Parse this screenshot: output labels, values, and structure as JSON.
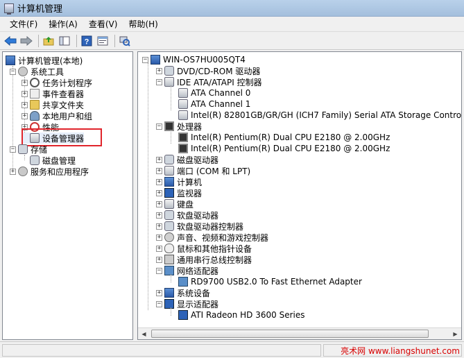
{
  "window": {
    "title": "计算机管理"
  },
  "menu": [
    "文件(F)",
    "操作(A)",
    "查看(V)",
    "帮助(H)"
  ],
  "toolbar": [
    "back-arrow-icon",
    "forward-arrow-icon",
    "up-folder-icon",
    "show-hide-tree-icon",
    "help-icon",
    "properties-icon",
    "scan-hardware-icon"
  ],
  "left_tree": {
    "root": "计算机管理(本地)",
    "system_tools": "系统工具",
    "task_scheduler": "任务计划程序",
    "event_viewer": "事件查看器",
    "shared_folders": "共享文件夹",
    "local_users": "本地用户和组",
    "performance": "性能",
    "device_manager": "设备管理器",
    "storage": "存储",
    "disk_management": "磁盘管理",
    "services_apps": "服务和应用程序"
  },
  "device_tree": {
    "computer_name": "WIN-OS7HU005QT4",
    "dvd": "DVD/CD-ROM 驱动器",
    "ide": "IDE ATA/ATAPI 控制器",
    "ide_children": [
      "ATA Channel 0",
      "ATA Channel 1",
      "Intel(R) 82801GB/GR/GH (ICH7 Family) Serial ATA Storage Controll"
    ],
    "processors": "处理器",
    "processor_children": [
      "Intel(R) Pentium(R) Dual  CPU  E2180  @ 2.00GHz",
      "Intel(R) Pentium(R) Dual  CPU  E2180  @ 2.00GHz"
    ],
    "disk_drives": "磁盘驱动器",
    "ports": "端口 (COM 和 LPT)",
    "computer": "计算机",
    "monitors": "监视器",
    "keyboards": "键盘",
    "floppy_drives": "软盘驱动器",
    "floppy_controllers": "软盘驱动器控制器",
    "sound": "声音、视频和游戏控制器",
    "mice": "鼠标和其他指针设备",
    "usb": "通用串行总线控制器",
    "network": "网络适配器",
    "network_children": [
      "RD9700 USB2.0 To Fast Ethernet Adapter"
    ],
    "system_devices": "系统设备",
    "display": "显示适配器",
    "display_children": [
      "ATI Radeon HD 3600 Series"
    ]
  },
  "status": {
    "watermark": "亮术网 www.liangshunet.com"
  },
  "colors": {
    "highlight_border": "#e0242b",
    "watermark": "#d80000"
  }
}
